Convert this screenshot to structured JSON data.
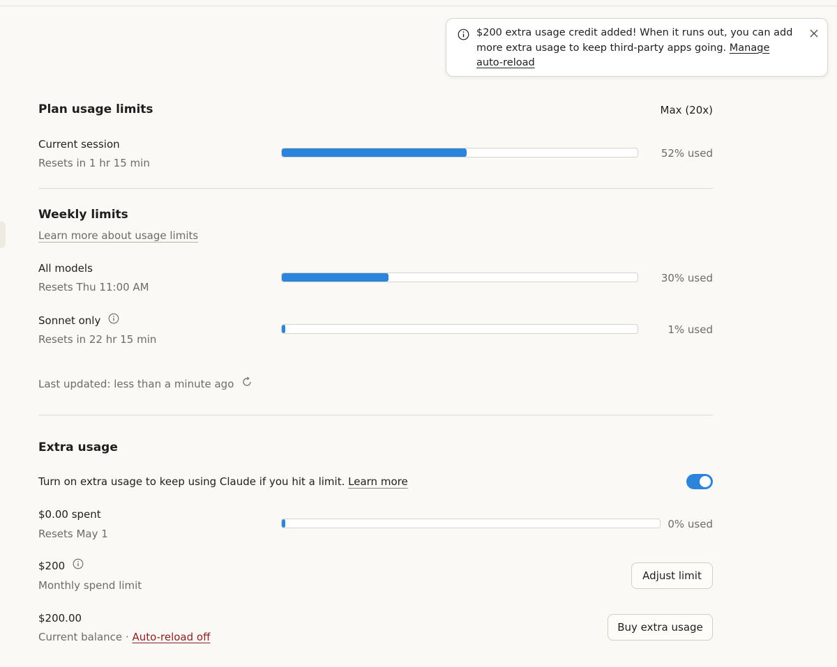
{
  "toast": {
    "message": "$200 extra usage credit added! When it runs out, you can add more extra usage to keep third-party apps going. ",
    "link_label": "Manage auto-reload"
  },
  "plan": {
    "title": "Plan usage limits",
    "plan_name": "Max (20x)",
    "session": {
      "label": "Current session",
      "reset": "Resets in 1 hr 15 min",
      "percent": 52,
      "percent_label": "52% used"
    }
  },
  "weekly": {
    "title": "Weekly limits",
    "learn_more": "Learn more about usage limits",
    "all_models": {
      "label": "All models",
      "reset": "Resets Thu 11:00 AM",
      "percent": 30,
      "percent_label": "30% used"
    },
    "sonnet": {
      "label": "Sonnet only",
      "reset": "Resets in 22 hr 15 min",
      "percent": 1,
      "percent_label": "1% used"
    },
    "last_updated": "Last updated: less than a minute ago"
  },
  "extra": {
    "title": "Extra usage",
    "toggle_text": "Turn on extra usage to keep using Claude if you hit a limit. ",
    "toggle_link": "Learn more",
    "toggle_on": true,
    "spent": {
      "label": "$0.00 spent",
      "reset": "Resets May 1",
      "percent": 0,
      "percent_label": "0% used"
    },
    "limit": {
      "amount": "$200",
      "label": "Monthly spend limit",
      "button": "Adjust limit"
    },
    "balance": {
      "amount": "$200.00",
      "label": "Current balance",
      "separator": " · ",
      "auto_reload": "Auto-reload off",
      "button": "Buy extra usage"
    }
  },
  "colors": {
    "accent": "#2c84db",
    "danger_link": "#8b1d1d",
    "background": "#faf9f5"
  }
}
